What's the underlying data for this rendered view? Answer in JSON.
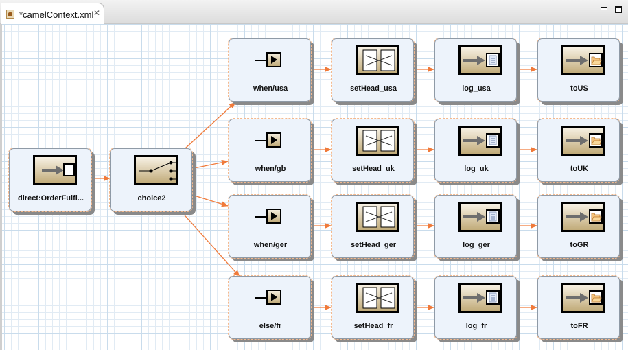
{
  "editor": {
    "tab_title": "*camelContext.xml",
    "tab_icon": "camel-file-icon",
    "close_icon": "close-icon",
    "minimize_icon": "minimize-icon",
    "maximize_icon": "maximize-icon"
  },
  "colors": {
    "edge": "#f07a3a",
    "node_fill": "#edf3fb",
    "icon_gradient_top": "#f7f1e4",
    "icon_gradient_bottom": "#c1ab79"
  },
  "route": {
    "from": {
      "label": "direct:OrderFulfi...",
      "icon": "endpoint-icon"
    },
    "choice": {
      "label": "choice2",
      "icon": "switch-icon"
    },
    "branches": [
      {
        "when": "when/usa",
        "setHeader": "setHead_usa",
        "log": "log_usa",
        "to": "toUS"
      },
      {
        "when": "when/gb",
        "setHeader": "setHead_uk",
        "log": "log_uk",
        "to": "toUK"
      },
      {
        "when": "when/ger",
        "setHeader": "setHead_ger",
        "log": "log_ger",
        "to": "toGR"
      },
      {
        "when": "else/fr",
        "setHeader": "setHead_fr",
        "log": "log_fr",
        "to": "toFR"
      }
    ]
  }
}
